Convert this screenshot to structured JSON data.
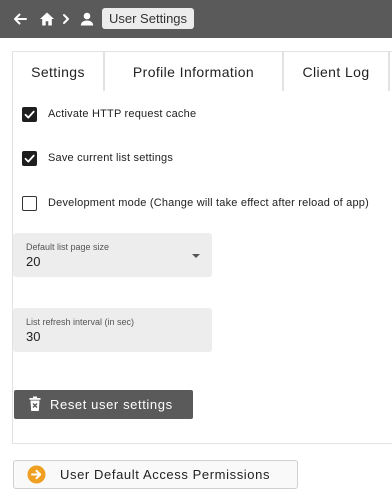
{
  "header": {
    "back_icon": "arrow-left-icon",
    "home_icon": "home-icon",
    "separator_icon": "chevron-right-icon",
    "user_icon": "person-icon",
    "current_page": "User Settings"
  },
  "tabs": [
    {
      "label": "Settings",
      "active": true
    },
    {
      "label": "Profile Information",
      "active": false
    },
    {
      "label": "Client Log",
      "active": false
    },
    {
      "label": "",
      "active": false
    }
  ],
  "settings": {
    "http_cache": {
      "label": "Activate HTTP request cache",
      "checked": true
    },
    "save_list": {
      "label": "Save current list settings",
      "checked": true
    },
    "dev_mode": {
      "label": "Development mode (Change will take effect after reload of app)",
      "checked": false
    }
  },
  "fields": {
    "page_size": {
      "label": "Default list page size",
      "value": "20"
    },
    "refresh_interval": {
      "label": "List refresh interval (in sec)",
      "value": "30"
    }
  },
  "buttons": {
    "reset": {
      "label": "Reset user settings",
      "icon": "trash-icon"
    },
    "permissions": {
      "label": "User Default Access Permissions",
      "icon": "arrow-right-circle-icon"
    }
  },
  "colors": {
    "header_bg": "#5a5a5a",
    "accent_orange": "#f0a020",
    "checkbox_fill": "#1e1e1e"
  }
}
